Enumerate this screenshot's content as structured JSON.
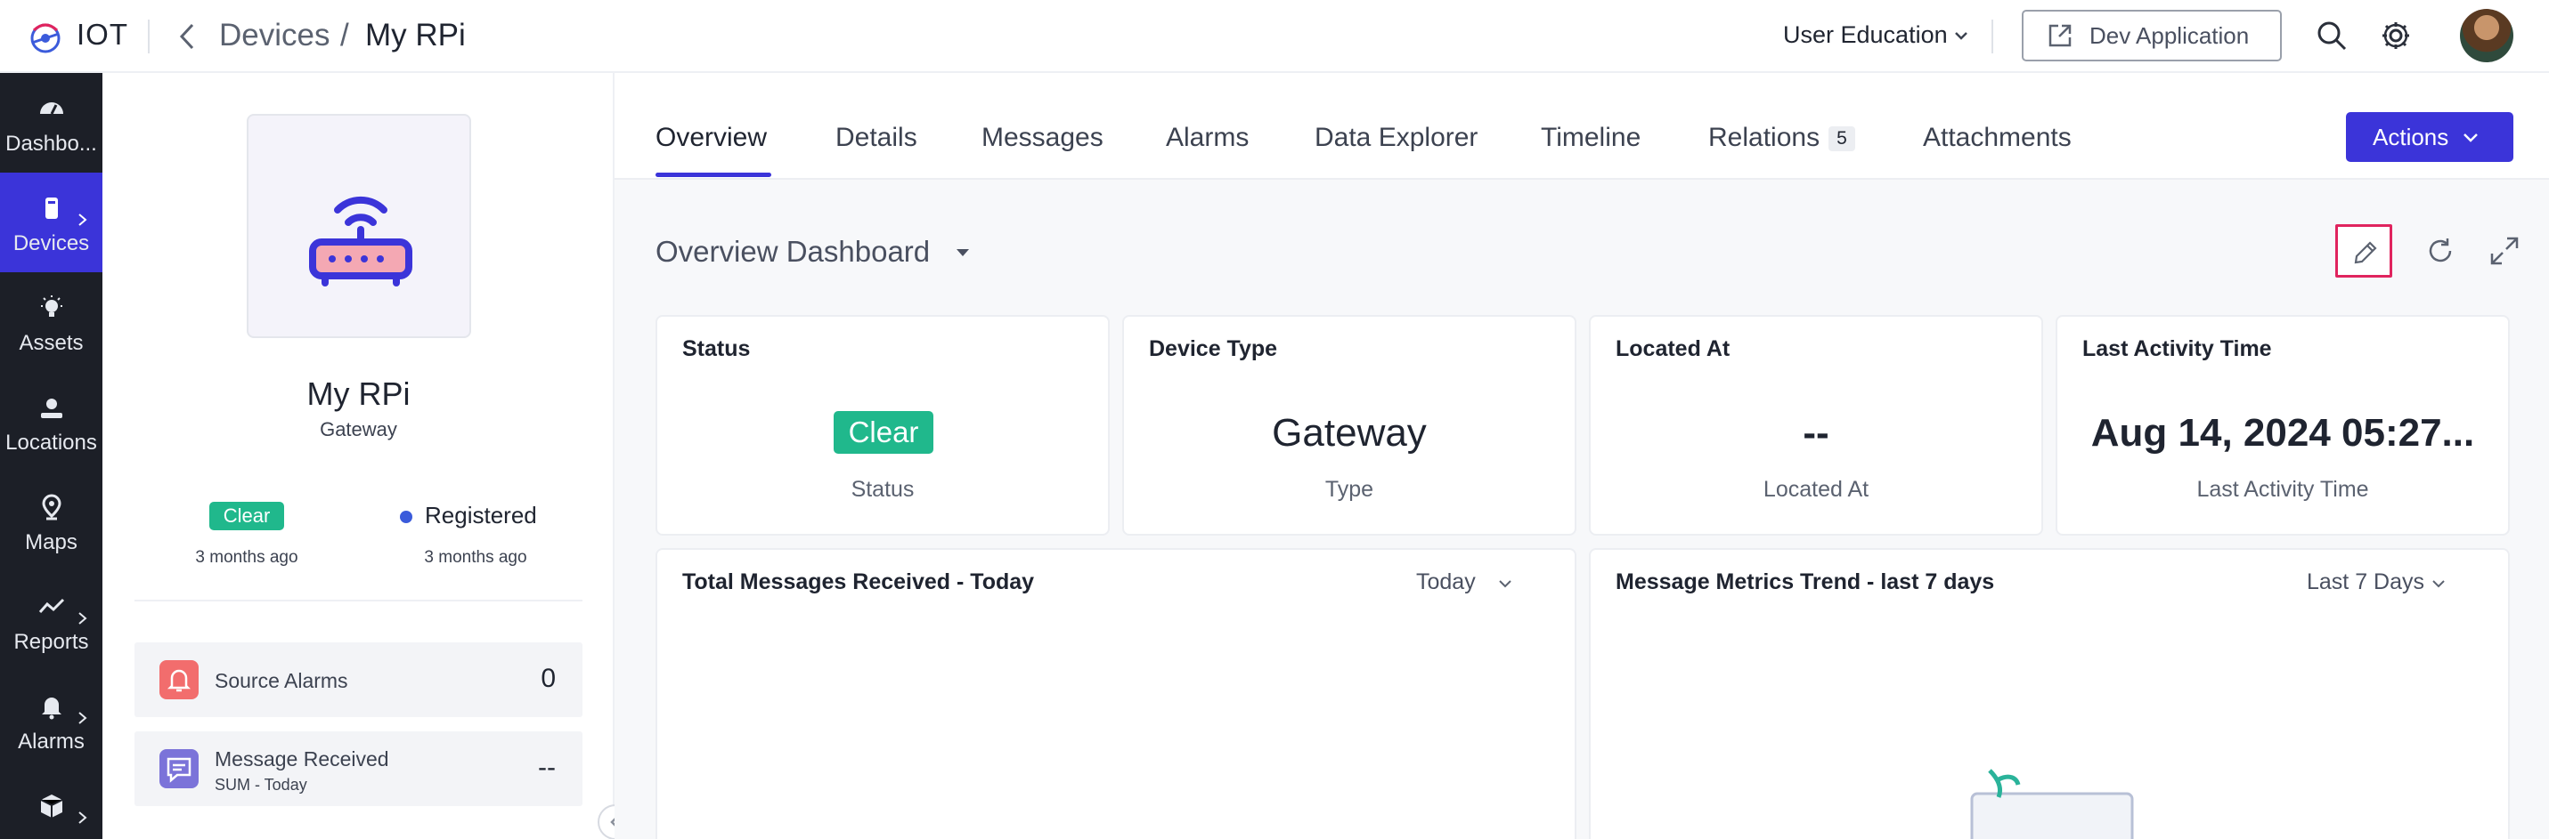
{
  "header": {
    "app_name": "IOT",
    "breadcrumb": {
      "parent": "Devices",
      "separator": "/",
      "current": "My RPi"
    },
    "workspace": "User Education",
    "dev_app_button": "Dev Application"
  },
  "nav": {
    "items": [
      {
        "label": "Dashbo...",
        "icon": "dashboard-icon",
        "active": false,
        "has_children": false
      },
      {
        "label": "Devices",
        "icon": "device-icon",
        "active": true,
        "has_children": true
      },
      {
        "label": "Assets",
        "icon": "bulb-icon",
        "active": false,
        "has_children": false
      },
      {
        "label": "Locations",
        "icon": "location-icon",
        "active": false,
        "has_children": false
      },
      {
        "label": "Maps",
        "icon": "map-pin-icon",
        "active": false,
        "has_children": false
      },
      {
        "label": "Reports",
        "icon": "trend-icon",
        "active": false,
        "has_children": true
      },
      {
        "label": "Alarms",
        "icon": "bell-icon",
        "active": false,
        "has_children": true
      },
      {
        "label": "",
        "icon": "box-icon",
        "active": false,
        "has_children": true
      }
    ]
  },
  "device": {
    "name": "My RPi",
    "type": "Gateway",
    "status_badge": "Clear",
    "status_time": "3 months ago",
    "registration_label": "Registered",
    "registration_time": "3 months ago",
    "stats": [
      {
        "label": "Source Alarms",
        "sub": "",
        "value": "0",
        "icon": "alarm-bell-icon",
        "icon_color": "#f26d6d"
      },
      {
        "label": "Message Received",
        "sub": "SUM - Today",
        "value": "--",
        "icon": "message-icon",
        "icon_color": "#7b73d9"
      }
    ]
  },
  "tabs": [
    {
      "label": "Overview",
      "active": true
    },
    {
      "label": "Details",
      "active": false
    },
    {
      "label": "Messages",
      "active": false
    },
    {
      "label": "Alarms",
      "active": false
    },
    {
      "label": "Data Explorer",
      "active": false
    },
    {
      "label": "Timeline",
      "active": false
    },
    {
      "label": "Relations",
      "active": false,
      "count": "5"
    },
    {
      "label": "Attachments",
      "active": false
    }
  ],
  "actions_button": "Actions",
  "dashboard": {
    "title": "Overview Dashboard",
    "cards": [
      {
        "title": "Status",
        "badge": "Clear",
        "subtitle": "Status"
      },
      {
        "title": "Device Type",
        "value": "Gateway",
        "subtitle": "Type"
      },
      {
        "title": "Located At",
        "value": "--",
        "subtitle": "Located At"
      },
      {
        "title": "Last Activity Time",
        "value": "Aug 14, 2024 05:27...",
        "subtitle": "Last Activity Time"
      }
    ],
    "widgets": [
      {
        "title": "Total Messages Received - Today",
        "filter": "Today"
      },
      {
        "title": "Message Metrics Trend - last 7 days",
        "filter": "Last 7 Days"
      }
    ]
  },
  "colors": {
    "accent": "#3b34d9",
    "sidebar_bg": "#1c1f27",
    "status_clear": "#20b88c",
    "edit_highlight": "#e0245e"
  }
}
